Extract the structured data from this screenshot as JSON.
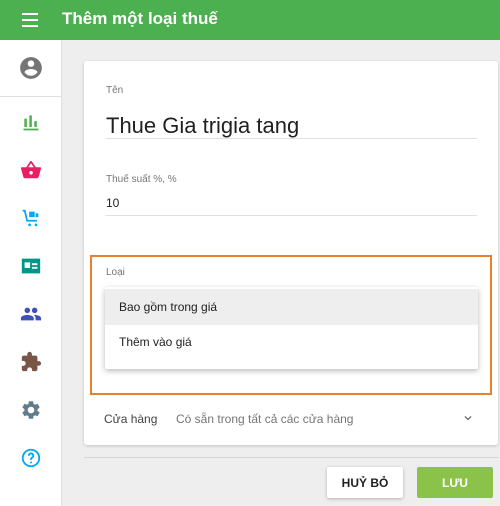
{
  "header": {
    "title": "Thêm một loại thuế"
  },
  "sidebar": {
    "items": [
      {
        "icon": "account-circle-icon",
        "color": "#757575"
      },
      {
        "icon": "bar-chart-icon",
        "color": "#4caf50"
      },
      {
        "icon": "basket-icon",
        "color": "#e91e63"
      },
      {
        "icon": "cart-icon",
        "color": "#03a9f4"
      },
      {
        "icon": "id-card-icon",
        "color": "#009688"
      },
      {
        "icon": "people-icon",
        "color": "#3f51b5"
      },
      {
        "icon": "puzzle-icon",
        "color": "#795548"
      },
      {
        "icon": "gear-icon",
        "color": "#607d8b"
      },
      {
        "icon": "help-icon",
        "color": "#03a9f4"
      }
    ]
  },
  "form": {
    "name_label": "Tên",
    "name_value": "Thue Gia trigia tang",
    "rate_label": "Thuế suất %, %",
    "rate_value": "10",
    "type_label": "Loại",
    "type_options": [
      "Bao gồm trong giá",
      "Thêm vào giá"
    ],
    "store_label": "Cửa hàng",
    "store_value": "Có sẵn trong tất cả các cửa hàng"
  },
  "actions": {
    "cancel_label": "HUỶ BỎ",
    "save_label": "LƯU"
  },
  "colors": {
    "header": "#4caf50",
    "highlight": "#e8802c",
    "save": "#8bc34a"
  }
}
